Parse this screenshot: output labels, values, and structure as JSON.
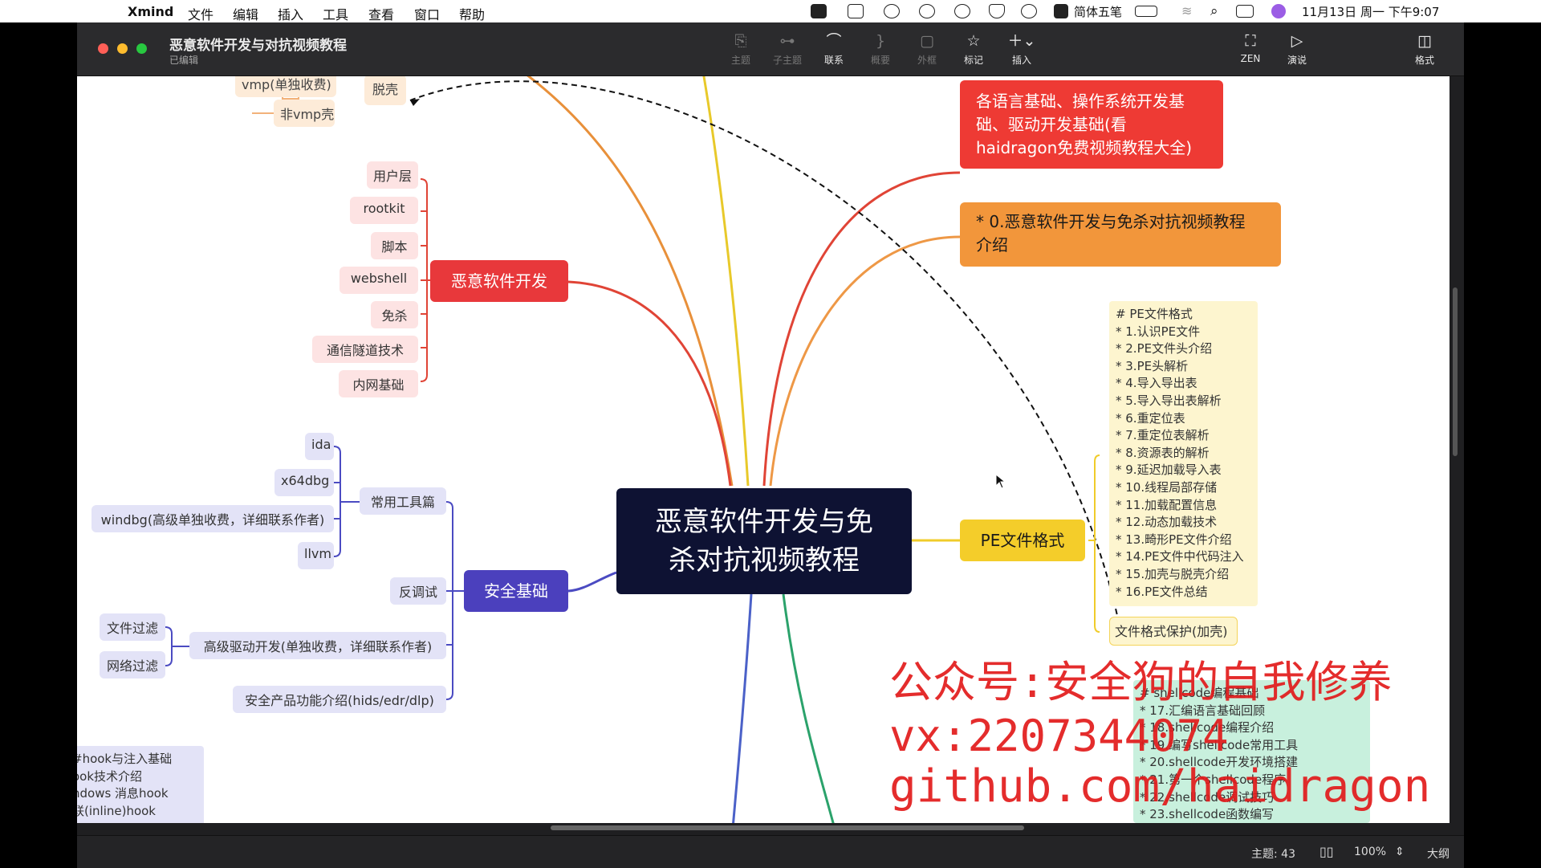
{
  "menubar": {
    "app": "Xmind",
    "items": [
      "文件",
      "编辑",
      "插入",
      "工具",
      "查看",
      "窗口",
      "帮助"
    ],
    "input_method": "简体五笔",
    "datetime": "11月13日 周一 下午9:07"
  },
  "window": {
    "title": "恶意软件开发与对抗视频教程",
    "status": "已编辑"
  },
  "toolbar": [
    {
      "label": "主题",
      "icon": "topic-icon",
      "enabled": false
    },
    {
      "label": "子主题",
      "icon": "subtopic-icon",
      "enabled": false
    },
    {
      "label": "联系",
      "icon": "relationship-icon",
      "enabled": true
    },
    {
      "label": "概要",
      "icon": "summary-icon",
      "enabled": false
    },
    {
      "label": "外框",
      "icon": "boundary-icon",
      "enabled": false
    },
    {
      "label": "标记",
      "icon": "star-icon",
      "enabled": true
    },
    {
      "label": "插入",
      "icon": "plus-icon",
      "enabled": true
    },
    {
      "label": "ZEN",
      "icon": "zen-icon",
      "enabled": true
    },
    {
      "label": "演说",
      "icon": "pitch-icon",
      "enabled": true
    },
    {
      "label": "格式",
      "icon": "format-icon",
      "enabled": true
    }
  ],
  "mindmap": {
    "central": [
      "恶意软件开发与免",
      "杀对抗视频教程"
    ],
    "branches": {
      "malware_dev": "恶意软件开发",
      "security_basics": "安全基础",
      "pe_format": "PE文件格式",
      "language_basics": [
        "各语言基础、操作系统开发基",
        "础、驱动开发基础(看",
        "haidragon免费视频教程大全)"
      ],
      "intro": [
        "* 0.恶意软件开发与免杀对抗视频教程",
        "介绍"
      ]
    },
    "shell_nodes": {
      "unpack": "脱壳",
      "vmp": "vmp(单独收费)",
      "non_vmp": "非vmp壳"
    },
    "malware_children": [
      "用户层",
      "rootkit",
      "脚本",
      "webshell",
      "免杀",
      "通信隧道技术",
      "内网基础"
    ],
    "security_children": {
      "tools": "常用工具篇",
      "tool_items": [
        "ida",
        "x64dbg",
        "windbg(高级单独收费，详细联系作者)",
        "llvm"
      ],
      "anti_debug": "反调试",
      "driver": "高级驱动开发(单独收费，详细联系作者)",
      "driver_items": [
        "文件过滤",
        "网络过滤"
      ],
      "products": "安全产品功能介绍(hids/edr/dlp)"
    },
    "pe_notes": "# PE文件格式\n* 1.认识PE文件\n* 2.PE文件头介绍\n* 3.PE头解析\n* 4.导入导出表\n* 5.导入导出表解析\n* 6.重定位表\n* 7.重定位表解析\n* 8.资源表的解析\n* 9.延迟加载导入表\n* 10.线程局部存储\n* 11.加载配置信息\n* 12.动态加载技术\n* 13.畸形PE文件介绍\n* 14.PE文件中代码注入\n* 15.加壳与脱壳介绍\n* 16.PE文件总结",
    "pe_protect": "文件格式保护(加壳)",
    "shellcode_notes": "# shellcode编程基础\n* 17.汇编语言基础回顾\n* 18.shellcode编程介绍\n* 19.编写shellcode常用工具\n* 20.shellcode开发环境搭建\n* 21.第一个shellcode程序\n* 22.shellcode调试技巧\n* 23.shellcode函数编写",
    "hook_notes": "#hook与注入基础\nook技术介绍\nndows 消息hook\n联(inline)hook"
  },
  "watermark": [
    "公众号:安全狗的自我修养",
    "vx:2207344074",
    "github.com/haidragon"
  ],
  "statusbar": {
    "topics": "主题: 43",
    "zoom": "100%",
    "outline": "大纲"
  }
}
